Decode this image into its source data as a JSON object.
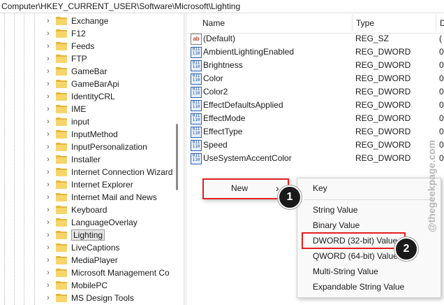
{
  "address_bar": {
    "path": "Computer\\HKEY_CURRENT_USER\\Software\\Microsoft\\Lighting"
  },
  "tree": {
    "items": [
      {
        "label": "Exchange",
        "selected": false
      },
      {
        "label": "F12",
        "selected": false
      },
      {
        "label": "Feeds",
        "selected": false
      },
      {
        "label": "FTP",
        "selected": false
      },
      {
        "label": "GameBar",
        "selected": false
      },
      {
        "label": "GameBarApi",
        "selected": false
      },
      {
        "label": "IdentityCRL",
        "selected": false
      },
      {
        "label": "IME",
        "selected": false
      },
      {
        "label": "input",
        "selected": false
      },
      {
        "label": "InputMethod",
        "selected": false
      },
      {
        "label": "InputPersonalization",
        "selected": false
      },
      {
        "label": "Installer",
        "selected": false
      },
      {
        "label": "Internet Connection Wizard",
        "selected": false
      },
      {
        "label": "Internet Explorer",
        "selected": false
      },
      {
        "label": "Internet Mail and News",
        "selected": false
      },
      {
        "label": "Keyboard",
        "selected": false
      },
      {
        "label": "LanguageOverlay",
        "selected": false
      },
      {
        "label": "Lighting",
        "selected": true
      },
      {
        "label": "LiveCaptions",
        "selected": false
      },
      {
        "label": "MediaPlayer",
        "selected": false
      },
      {
        "label": "Microsoft Management Co",
        "selected": false
      },
      {
        "label": "MobilePC",
        "selected": false
      },
      {
        "label": "MS Design Tools",
        "selected": false
      }
    ]
  },
  "values_list": {
    "columns": {
      "name": "Name",
      "type": "Type",
      "data": "D"
    },
    "rows": [
      {
        "icon": "string-value-icon",
        "name": "(Default)",
        "type": "REG_SZ",
        "data": "("
      },
      {
        "icon": "binary-value-icon",
        "name": "AmbientLightingEnabled",
        "type": "REG_DWORD",
        "data": "0"
      },
      {
        "icon": "binary-value-icon",
        "name": "Brightness",
        "type": "REG_DWORD",
        "data": "0"
      },
      {
        "icon": "binary-value-icon",
        "name": "Color",
        "type": "REG_DWORD",
        "data": "0"
      },
      {
        "icon": "binary-value-icon",
        "name": "Color2",
        "type": "REG_DWORD",
        "data": "0"
      },
      {
        "icon": "binary-value-icon",
        "name": "EffectDefaultsApplied",
        "type": "REG_DWORD",
        "data": "0"
      },
      {
        "icon": "binary-value-icon",
        "name": "EffectMode",
        "type": "REG_DWORD",
        "data": "0"
      },
      {
        "icon": "binary-value-icon",
        "name": "EffectType",
        "type": "REG_DWORD",
        "data": "0"
      },
      {
        "icon": "binary-value-icon",
        "name": "Speed",
        "type": "REG_DWORD",
        "data": "0"
      },
      {
        "icon": "binary-value-icon",
        "name": "UseSystemAccentColor",
        "type": "REG_DWORD",
        "data": "0"
      }
    ]
  },
  "context_menu": {
    "new_label": "New",
    "arrow": "›"
  },
  "submenu": {
    "key_label": "Key",
    "items": [
      "String Value",
      "Binary Value",
      "DWORD (32-bit) Value",
      "QWORD (64-bit) Value",
      "Multi-String Value",
      "Expandable String Value"
    ]
  },
  "annotations": {
    "step1": "1",
    "step2": "2",
    "highlight_color": "#e02020"
  },
  "watermark": {
    "text": "@thegeekpage.com"
  },
  "string_icon_text": "ab",
  "binary_icon_text": "011\n110"
}
